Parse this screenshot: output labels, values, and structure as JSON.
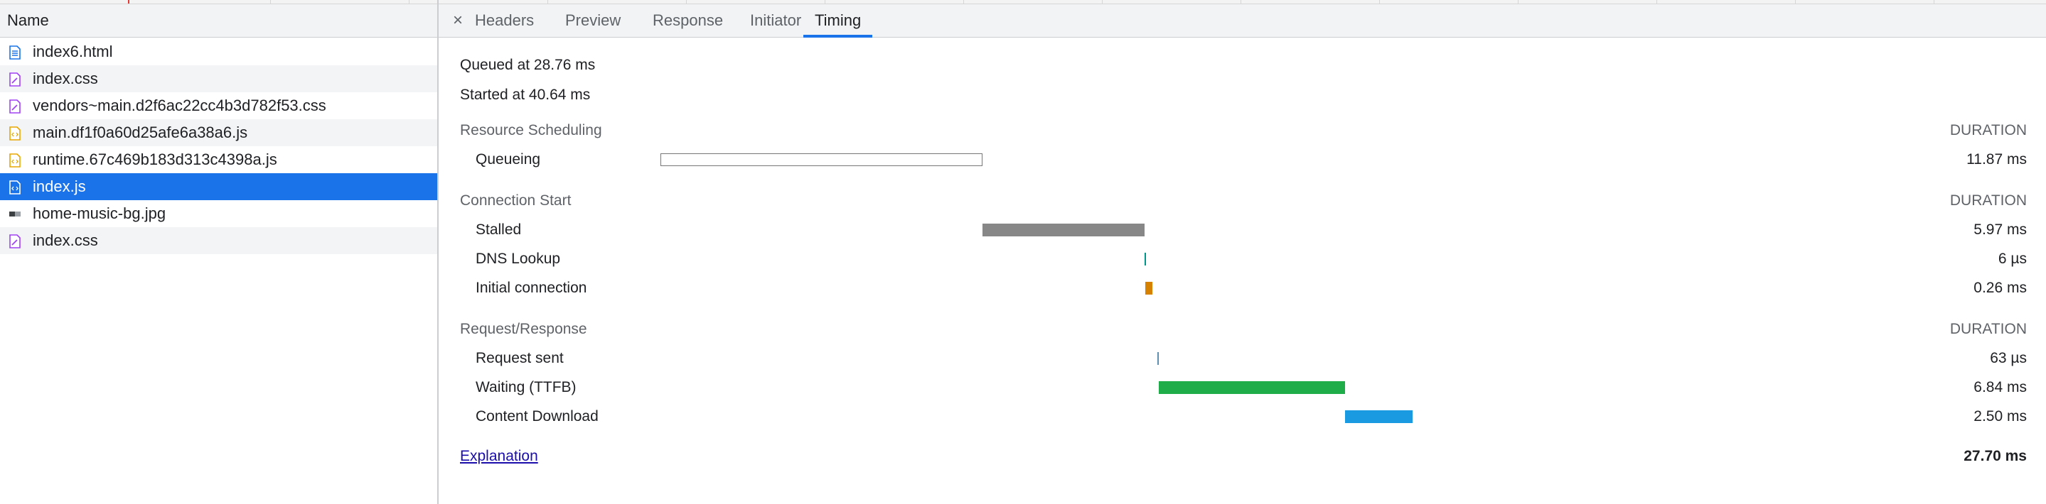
{
  "request_list": {
    "header": "Name",
    "items": [
      {
        "name": "index6.html",
        "type": "document"
      },
      {
        "name": "index.css",
        "type": "stylesheet"
      },
      {
        "name": "vendors~main.d2f6ac22cc4b3d782f53.css",
        "type": "stylesheet"
      },
      {
        "name": "main.df1f0a60d25afe6a38a6.js",
        "type": "script"
      },
      {
        "name": "runtime.67c469b183d313c4398a.js",
        "type": "script"
      },
      {
        "name": "index.js",
        "type": "script",
        "selected": true
      },
      {
        "name": "home-music-bg.jpg",
        "type": "image"
      },
      {
        "name": "index.css",
        "type": "stylesheet"
      }
    ]
  },
  "tabs": {
    "close_glyph": "×",
    "items": [
      "Headers",
      "Preview",
      "Response",
      "Initiator",
      "Timing"
    ],
    "active": "Timing"
  },
  "timing": {
    "queued_at": "Queued at 28.76 ms",
    "started_at": "Started at 40.64 ms",
    "duration_header": "DURATION",
    "sections": [
      {
        "title": "Resource Scheduling",
        "phases": [
          {
            "label": "Queueing",
            "value": "11.87 ms",
            "start_ms": 0.0,
            "dur_ms": 11.87,
            "color": "#ffffff",
            "outline": true
          }
        ]
      },
      {
        "title": "Connection Start",
        "phases": [
          {
            "label": "Stalled",
            "value": "5.97 ms",
            "start_ms": 11.87,
            "dur_ms": 5.97,
            "color": "#878787"
          },
          {
            "label": "DNS Lookup",
            "value": "6 µs",
            "start_ms": 17.84,
            "dur_ms": 0.006,
            "color": "#009688"
          },
          {
            "label": "Initial connection",
            "value": "0.26 ms",
            "start_ms": 17.85,
            "dur_ms": 0.26,
            "color": "#d68100"
          }
        ]
      },
      {
        "title": "Request/Response",
        "phases": [
          {
            "label": "Request sent",
            "value": "63 µs",
            "start_ms": 18.3,
            "dur_ms": 0.063,
            "color": "#5f8fb0"
          },
          {
            "label": "Waiting (TTFB)",
            "value": "6.84 ms",
            "start_ms": 18.36,
            "dur_ms": 6.84,
            "color": "#1fad4a"
          },
          {
            "label": "Content Download",
            "value": "2.50 ms",
            "start_ms": 25.2,
            "dur_ms": 2.5,
            "color": "#1a9ae0"
          }
        ]
      }
    ],
    "explanation_link": "Explanation",
    "total": "27.70 ms"
  }
}
